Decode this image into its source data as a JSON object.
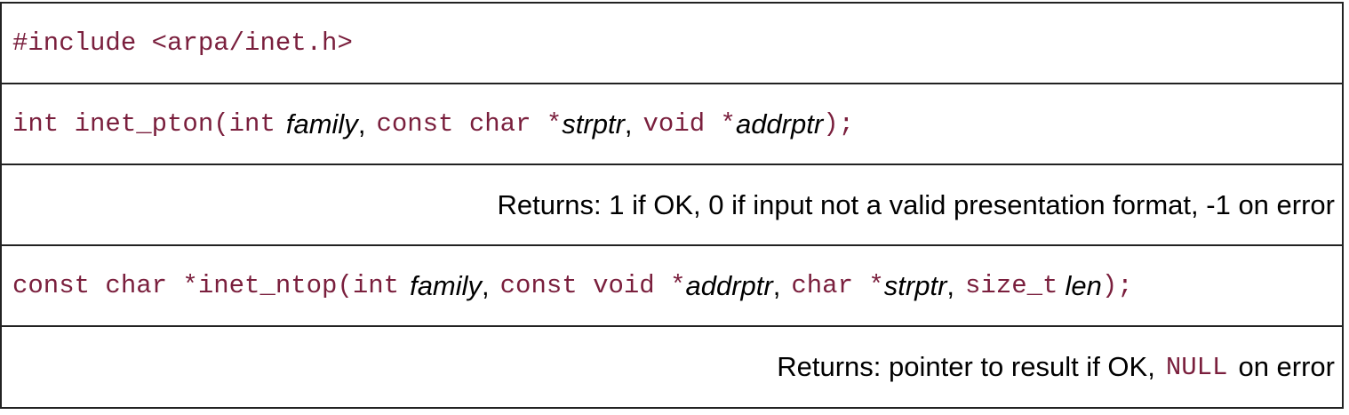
{
  "header": {
    "include": "#include <arpa/inet.h>"
  },
  "pton": {
    "prefix": "int inet_pton(int",
    "arg1": "family",
    "comma1": ",",
    "type2": "const char *",
    "arg2": "strptr",
    "comma2": ",",
    "type3": "void *",
    "arg3": "addrptr",
    "suffix": ");",
    "returns": "Returns: 1 if OK, 0 if input not a valid presentation format, -1 on error"
  },
  "ntop": {
    "prefix": "const char *inet_ntop(int",
    "arg1": "family",
    "comma1": ",",
    "type2": "const void *",
    "arg2": "addrptr",
    "comma2": ",",
    "type3": "char *",
    "arg3": "strptr",
    "comma3": ",",
    "type4": "size_t",
    "arg4": "len",
    "suffix": ");",
    "returns_prefix": "Returns: pointer to result if OK,",
    "returns_null": "NULL",
    "returns_suffix": "on error"
  },
  "colors": {
    "code": "#7a1f3d",
    "text": "#000000",
    "border": "#222222"
  }
}
